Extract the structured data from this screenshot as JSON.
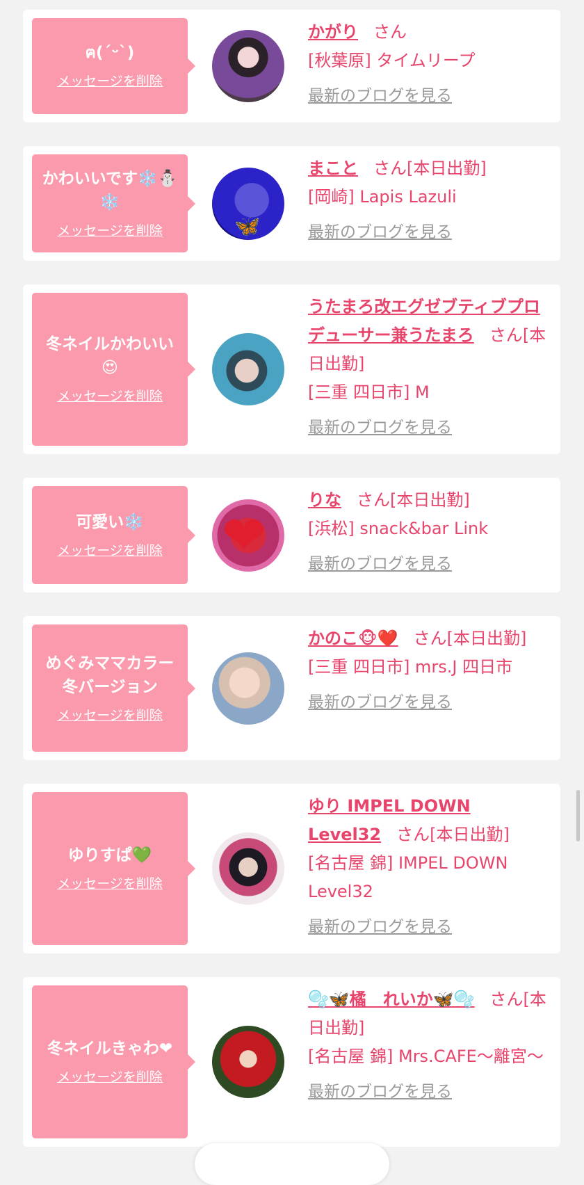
{
  "delete_label": "メッセージを削除",
  "blog_label": "最新のブログを見る",
  "san_label": "さん",
  "colors": {
    "bubble": "#fa9aac",
    "accent": "#e8456c",
    "link_gray": "#9a9a9a"
  },
  "cards": [
    {
      "message": "ฅ(ˊᵕˋ)",
      "name": "かがり",
      "suffix": "",
      "shop": "[秋葉原] タイムリープ",
      "avatar_icon": "girl-photo-avatar"
    },
    {
      "message": "かわいいです❄️⛄❄️",
      "name": "まこと",
      "suffix": "[本日出勤]",
      "shop": "[岡崎] Lapis Lazuli",
      "avatar_icon": "girl-photo-avatar"
    },
    {
      "message": "冬ネイルかわいい😍",
      "name": "うたまろ改エグゼブティブプロデューサー兼うたまろ",
      "suffix": "[本日出勤]",
      "shop": "[三重 四日市] M",
      "avatar_icon": "girl-photo-avatar"
    },
    {
      "message": "可愛い❄️",
      "name": "りな",
      "suffix": "[本日出勤]",
      "shop": "[浜松] snack&bar Link",
      "avatar_icon": "heart-avatar"
    },
    {
      "message": "めぐみママカラー冬バージョン",
      "name": "かのこ🐵❤️",
      "suffix": "[本日出勤]",
      "shop": "[三重 四日市] mrs.J 四日市",
      "avatar_icon": "girl-photo-avatar"
    },
    {
      "message": "ゆりすぱ💚",
      "name": "ゆり IMPEL DOWN Level32",
      "suffix": "[本日出勤]",
      "shop": "[名古屋 錦] IMPEL DOWN Level32",
      "avatar_icon": "girl-photo-avatar"
    },
    {
      "message": "冬ネイルきゃわ❤",
      "name": "🫧🦋橘　れいか🦋🫧",
      "suffix": "[本日出勤]",
      "shop": "[名古屋 錦] Mrs.CAFE～離宮～",
      "avatar_icon": "santa-girl-avatar"
    }
  ]
}
